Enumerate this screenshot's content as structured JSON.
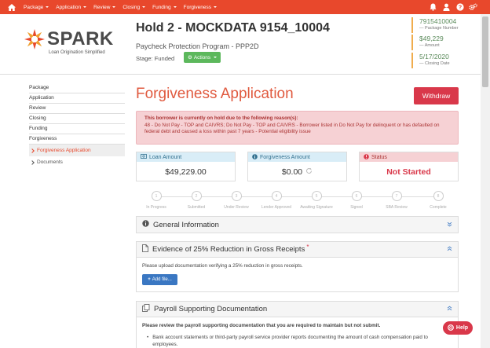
{
  "nav": {
    "home_icon": "home-icon",
    "items": [
      {
        "label": "Package"
      },
      {
        "label": "Application"
      },
      {
        "label": "Review"
      },
      {
        "label": "Closing"
      },
      {
        "label": "Funding"
      },
      {
        "label": "Forgiveness"
      }
    ],
    "right_icons": [
      "bell-icon",
      "user-icon",
      "help-circle-icon",
      "gears-icon"
    ],
    "bg_color": "#e8482c"
  },
  "header": {
    "logo_word": "SPARK",
    "logo_tagline": "Loan Origination Simplified",
    "title": "Hold 2 - MOCKDATA 9154_10004",
    "program": "Paycheck Protection Program - PPP2D",
    "stage": "Stage: Funded",
    "actions_label": "Actions",
    "meta": [
      {
        "value": "7915410004",
        "label": "— Package Number"
      },
      {
        "value": "$49,229",
        "label": "— Amount"
      },
      {
        "value": "5/17/2020",
        "label": "— Closing Date"
      }
    ]
  },
  "sidebar": {
    "items": [
      "Package",
      "Application",
      "Review",
      "Closing",
      "Funding",
      "Forgiveness"
    ],
    "sub_items": [
      "Forgiveness Application",
      "Documents"
    ]
  },
  "main": {
    "title": "Forgiveness Application",
    "withdraw_label": "Withdraw",
    "alert_head": "This borrower is currently on hold due to the following reason(s):",
    "alert_body": "48 - Do Not Pay - TOP and CAIVRS; Do Not Pay - TOP and CAIVRS - Borrower listed in Do Not Pay for delinquent or has defaulted on federal debt and caused a loss within past 7 years - Potential eligibility issue",
    "cards": [
      {
        "label": "Loan Amount",
        "value": "$49,229.00",
        "icon": "money-icon"
      },
      {
        "label": "Forgiveness Amount",
        "value": "$0.00",
        "icon": "info-icon"
      },
      {
        "label": "Status",
        "value": "Not Started",
        "icon": "exclamation-icon"
      }
    ],
    "steps": [
      {
        "num": "1",
        "label": "In Progress"
      },
      {
        "num": "2",
        "label": "Submitted"
      },
      {
        "num": "3",
        "label": "Under Review"
      },
      {
        "num": "4",
        "label": "Lender Approved"
      },
      {
        "num": "5",
        "label": "Awaiting Signature"
      },
      {
        "num": "6",
        "label": "Signed"
      },
      {
        "num": "7",
        "label": "SBA Review"
      },
      {
        "num": "8",
        "label": "Complete"
      }
    ],
    "panels": {
      "general": {
        "title": "General Information"
      },
      "evidence": {
        "title": "Evidence of 25% Reduction in Gross Receipts",
        "required_mark": "*",
        "body": "Please upload documentation verifying a 25% reduction in gross receipts.",
        "add_file_label": "Add file..."
      },
      "payroll": {
        "title": "Payroll Supporting Documentation",
        "intro": "Please review the payroll supporting documentation that you are required to maintain but not submit.",
        "bullet": "Bank account statements or third-party payroll service provider reports documenting the amount of cash compensation paid to employees."
      }
    },
    "help_label": "Help"
  }
}
